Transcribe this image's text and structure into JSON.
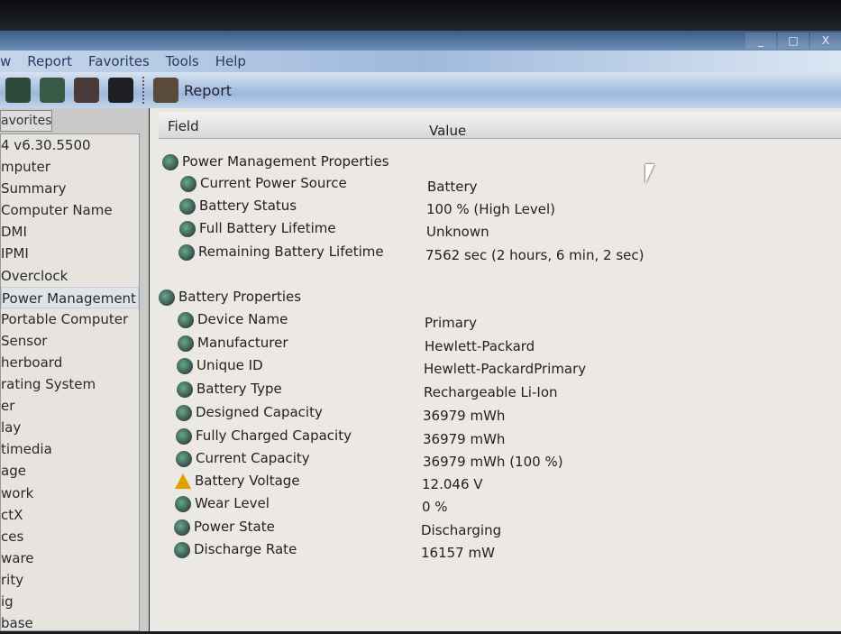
{
  "menu": [
    "w",
    "Report",
    "Favorites",
    "Tools",
    "Help"
  ],
  "toolbar": {
    "report_label": "Report"
  },
  "window_controls": [
    "_",
    "□",
    "X"
  ],
  "left": {
    "tab": "avorites",
    "items": [
      "4 v6.30.5500",
      "mputer",
      "Summary",
      "Computer Name",
      "DMI",
      "IPMI",
      "Overclock",
      "Power Management",
      "Portable Computer",
      "Sensor",
      "herboard",
      "rating System",
      "er",
      "lay",
      "timedia",
      "age",
      "work",
      "ctX",
      "ces",
      "ware",
      "rity",
      "ig",
      "base"
    ],
    "selected_index": 7
  },
  "columns": {
    "field": "Field",
    "value": "Value"
  },
  "sections": [
    {
      "title": "Power Management Properties",
      "rows": [
        {
          "field": "Current Power Source",
          "value": "Battery",
          "icon": "power-icon"
        },
        {
          "field": "Battery Status",
          "value": "100 % (High Level)",
          "icon": "power-icon"
        },
        {
          "field": "Full Battery Lifetime",
          "value": "Unknown",
          "icon": "power-icon"
        },
        {
          "field": "Remaining Battery Lifetime",
          "value": "7562 sec (2 hours, 6 min, 2 sec)",
          "icon": "power-icon"
        }
      ]
    },
    {
      "title": "Battery Properties",
      "rows": [
        {
          "field": "Device Name",
          "value": "Primary",
          "icon": "battery-icon"
        },
        {
          "field": "Manufacturer",
          "value": "Hewlett-Packard",
          "icon": "battery-icon"
        },
        {
          "field": "Unique ID",
          "value": "Hewlett-PackardPrimary",
          "icon": "battery-icon"
        },
        {
          "field": "Battery Type",
          "value": "Rechargeable Li-Ion",
          "icon": "battery-icon"
        },
        {
          "field": "Designed Capacity",
          "value": "36979 mWh",
          "icon": "battery-icon"
        },
        {
          "field": "Fully Charged Capacity",
          "value": "36979 mWh",
          "icon": "battery-icon"
        },
        {
          "field": "Current Capacity",
          "value": "36979 mWh  (100 %)",
          "icon": "battery-icon"
        },
        {
          "field": "Battery Voltage",
          "value": "12.046 V",
          "icon": "warning-icon"
        },
        {
          "field": "Wear Level",
          "value": "0 %",
          "icon": "battery-icon"
        },
        {
          "field": "Power State",
          "value": "Discharging",
          "icon": "battery-icon"
        },
        {
          "field": "Discharge Rate",
          "value": "16157 mW",
          "icon": "battery-icon"
        }
      ]
    }
  ]
}
